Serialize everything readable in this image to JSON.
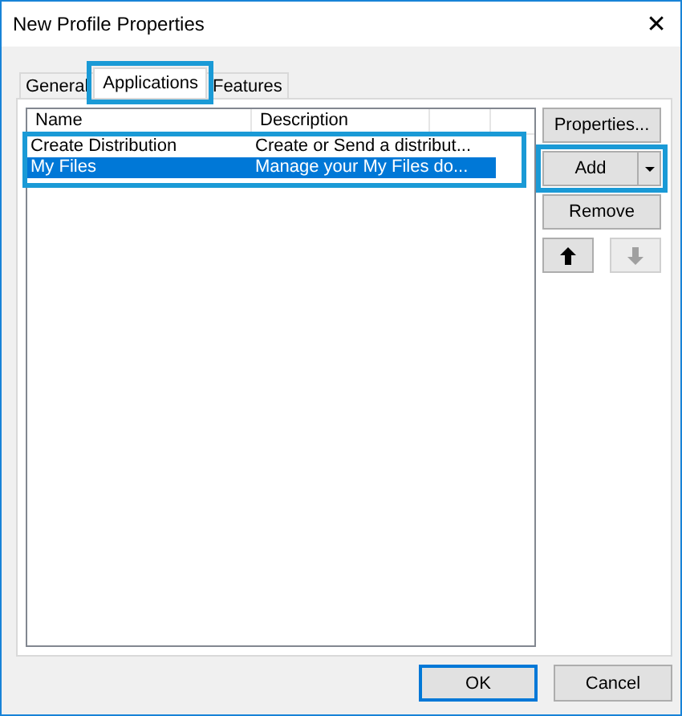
{
  "window": {
    "title": "New Profile Properties",
    "close": "✕"
  },
  "tabs": [
    {
      "label": "General",
      "selected": false,
      "highlighted": false
    },
    {
      "label": "Applications",
      "selected": true,
      "highlighted": true
    },
    {
      "label": "Features",
      "selected": false,
      "highlighted": false
    }
  ],
  "list": {
    "columns": [
      "Name",
      "Description"
    ],
    "rows_highlighted": true,
    "rows": [
      {
        "name": "Create Distribution",
        "description": "Create or Send a distribut...",
        "selected": false
      },
      {
        "name": "My Files",
        "description": "Manage your My Files do...",
        "selected": true
      }
    ]
  },
  "side_buttons": [
    {
      "kind": "button",
      "label": "Properties...",
      "highlighted": false
    },
    {
      "kind": "split",
      "label": "Add",
      "highlighted": true
    },
    {
      "kind": "button",
      "label": "Remove",
      "highlighted": false
    },
    {
      "kind": "arrows",
      "up_disabled": false,
      "down_disabled": true
    }
  ],
  "buttons": [
    {
      "label": "OK",
      "default": true
    },
    {
      "label": "Cancel",
      "default": false
    }
  ]
}
